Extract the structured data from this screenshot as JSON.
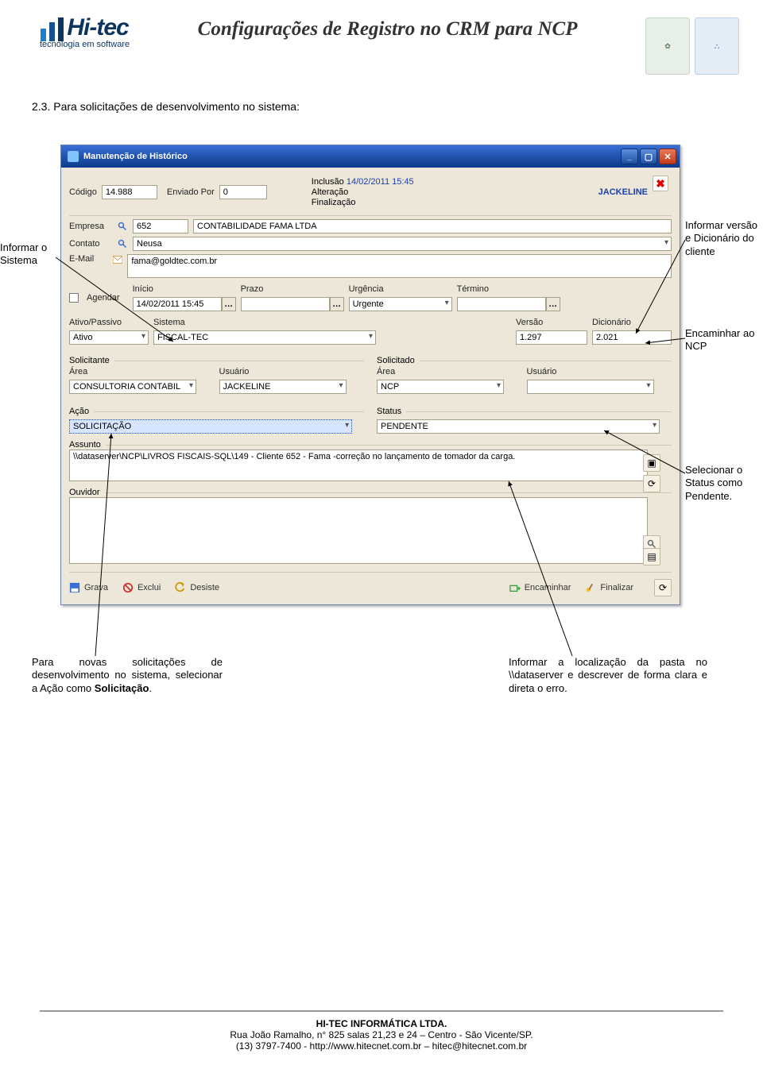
{
  "header": {
    "logo_main": "Hi-tec",
    "logo_sub": "tecnologia em software",
    "title": "Configurações de Registro no CRM para NCP"
  },
  "section_heading": "2.3. Para solicitações de desenvolvimento no sistema:",
  "window": {
    "title": "Manutenção de Histórico",
    "codigo_label": "Código",
    "codigo_value": "14.988",
    "enviado_por_label": "Enviado Por",
    "enviado_por_value": "0",
    "inclusao_label": "Inclusão",
    "inclusao_value": "14/02/2011 15:45",
    "alteracao_label": "Alteração",
    "finalizacao_label": "Finalização",
    "user_top": "JACKELINE",
    "empresa_label": "Empresa",
    "empresa_code": "652",
    "empresa_name": "CONTABILIDADE FAMA LTDA",
    "contato_label": "Contato",
    "contato_value": "Neusa",
    "email_label": "E-Mail",
    "email_value": "fama@goldtec.com.br",
    "agendar_label": "Agendar",
    "inicio_label": "Início",
    "inicio_value": "14/02/2011 15:45",
    "prazo_label": "Prazo",
    "urgencia_label": "Urgência",
    "urgencia_value": "Urgente",
    "termino_label": "Término",
    "ativo_label": "Ativo/Passivo",
    "ativo_value": "Ativo",
    "sistema_label": "Sistema",
    "sistema_value": "FISCAL-TEC",
    "versao_label": "Versão",
    "versao_value": "1.297",
    "dicionario_label": "Dicionário",
    "dicionario_value": "2.021",
    "solicitante_label": "Solicitante",
    "solicitado_label": "Solicitado",
    "area1_label": "Área",
    "area1_value": "CONSULTORIA CONTABIL",
    "usuario1_label": "Usuário",
    "usuario1_value": "JACKELINE",
    "area2_label": "Área",
    "area2_value": "NCP",
    "usuario2_label": "Usuário",
    "acao_group": "Ação",
    "acao_value": "SOLICITAÇÃO",
    "status_group": "Status",
    "status_value": "PENDENTE",
    "assunto_group": "Assunto",
    "assunto_value": "\\\\dataserver\\NCP\\LIVROS FISCAIS-SQL\\149 - Cliente 652 - Fama -correção no lançamento de tomador da carga.",
    "ouvidor_group": "Ouvidor",
    "buttons": {
      "grava": "Grava",
      "exclui": "Exclui",
      "desiste": "Desiste",
      "encaminhar": "Encaminhar",
      "finalizar": "Finalizar"
    }
  },
  "callouts": {
    "left1": "Informar o Sistema",
    "right1": "Informar versão e Dicionário do cliente",
    "right2": "Encaminhar ao NCP",
    "right3": "Selecionar o Status como Pendente.",
    "bottom_left": "Para novas solicitações de desenvolvimento no sistema, selecionar a Ação como Solicitação.",
    "bottom_right": "Informar a localização da pasta no \\\\dataserver e descrever de forma clara e direta o erro."
  },
  "footer": {
    "line1": "HI-TEC INFORMÁTICA LTDA.",
    "line2": "Rua João Ramalho, n° 825 salas 21,23 e 24 – Centro - São Vicente/SP.",
    "line3": "(13) 3797-7400 - http://www.hitecnet.com.br – hitec@hitecnet.com.br"
  }
}
